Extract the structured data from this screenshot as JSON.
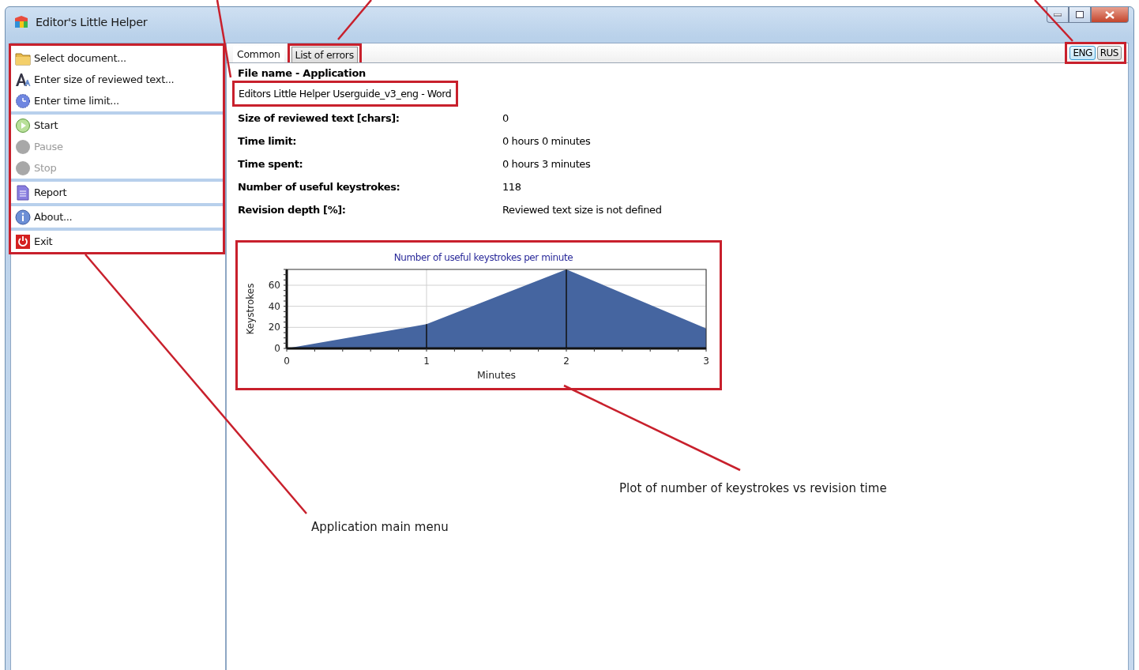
{
  "window": {
    "title": "Editor's Little Helper"
  },
  "menu": [
    [
      {
        "label": "Select document...",
        "kind": "folder",
        "disabled": false
      },
      {
        "label": "Enter size of reviewed text...",
        "kind": "font",
        "disabled": false
      },
      {
        "label": "Enter time limit...",
        "kind": "clock",
        "disabled": false
      }
    ],
    [
      {
        "label": "Start",
        "kind": "play",
        "disabled": false
      },
      {
        "label": "Pause",
        "kind": "pause",
        "disabled": true
      },
      {
        "label": "Stop",
        "kind": "stop",
        "disabled": true
      }
    ],
    [
      {
        "label": "Report",
        "kind": "report",
        "disabled": false
      }
    ],
    [
      {
        "label": "About...",
        "kind": "info",
        "disabled": false
      }
    ],
    [
      {
        "label": "Exit",
        "kind": "power",
        "disabled": false
      }
    ]
  ],
  "tabs": [
    {
      "label": "Common",
      "selected": true
    },
    {
      "label": "List of errors",
      "selected": false
    }
  ],
  "languages": [
    {
      "label": "ENG",
      "selected": true
    },
    {
      "label": "RUS",
      "selected": false
    }
  ],
  "file": {
    "heading": "File name - Application",
    "value": "Editors Little Helper Userguide_v3_eng - Word"
  },
  "fields": [
    {
      "label": "Size of reviewed text [chars]:",
      "value": "0"
    },
    {
      "label": "Time limit:",
      "value": "0 hours 0 minutes"
    },
    {
      "label": "Time spent:",
      "value": "0 hours 3 minutes"
    },
    {
      "label": "Number of useful keystrokes:",
      "value": "118"
    },
    {
      "label": "Revision depth [%]:",
      "value": "Reviewed text size is not defined"
    }
  ],
  "chart": {
    "chart_data": {
      "type": "area",
      "title": "Number of useful keystrokes per minute",
      "xlabel": "Minutes",
      "ylabel": "Keystrokes",
      "x": [
        0,
        1,
        2,
        3
      ],
      "series": [
        {
          "color": "#4565a0",
          "values": [
            0,
            23,
            75,
            19
          ]
        }
      ],
      "xlim": [
        0,
        3
      ],
      "ylim": [
        0,
        75
      ],
      "xticks": [
        0,
        1,
        2,
        3
      ],
      "yticks": [
        0,
        20,
        40,
        60
      ],
      "grid": true,
      "ref_lines": [
        {
          "axis": "x",
          "value": 1,
          "color": "#111111"
        },
        {
          "axis": "x",
          "value": 2,
          "color": "#111111"
        }
      ]
    }
  },
  "annotations": [
    {
      "text": "Plot of number of keystrokes vs revision time"
    },
    {
      "text": "Application main menu"
    }
  ]
}
